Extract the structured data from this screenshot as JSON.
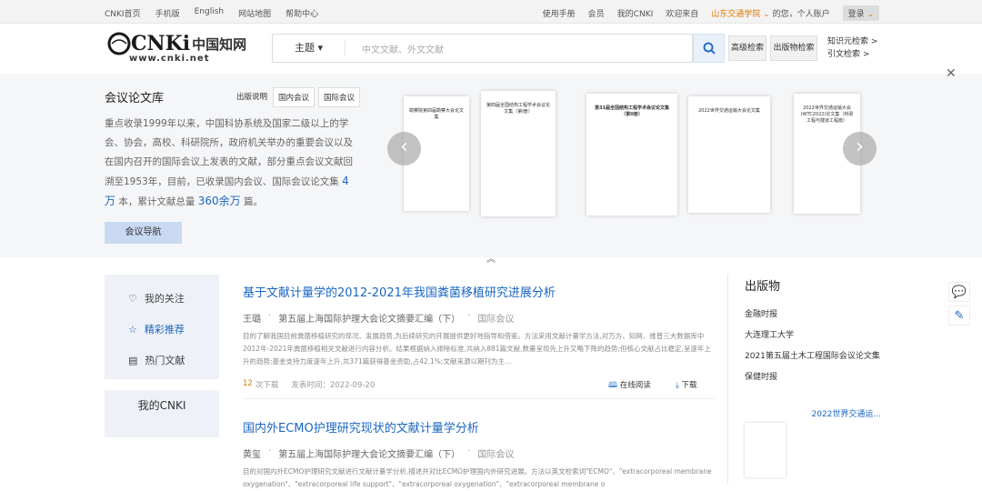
{
  "topbar": {
    "left": [
      "CNKI首页",
      "手机版",
      "English",
      "网站地图",
      "帮助中心"
    ],
    "right": [
      "使用手册",
      "会员",
      "我的CNKI",
      "欢迎来自"
    ],
    "org": "山东交通学院",
    "org_suffix": "的您，个人账户",
    "login": "登录"
  },
  "logo": {
    "mark": "CNKi",
    "cn": "中国知网",
    "url": "www.cnki.net"
  },
  "search": {
    "scope": "主题",
    "placeholder": "中文文献、外文文献"
  },
  "buttons": {
    "advanced": "高级检索",
    "publication": "出版物检索",
    "knowledge": "知识元检索",
    "citation": "引文检索"
  },
  "hero": {
    "title": "会议论文库",
    "tabs": [
      "出版说明",
      "国内会议",
      "国际会议"
    ],
    "desc_1": "重点收录1999年以来，中国科协系统及国家二级以上的学会、协会，高校、科研院所，政府机关举办的重要会议以及在国内召开的国际会议上发表的文献，部分重点会议文献回溯至1953年，目前，已收录国内会议、国际会议论文集",
    "num_1": "4万",
    "desc_2": "本，累计文献总量",
    "num_2": "360余万",
    "desc_3": "篇。",
    "nav_button": "会议导航",
    "books": [
      "勘察院第四届勘察大会论文集",
      "第四届全国结构工程学术会议论文集（第I册）",
      "第31届全国结构工程学术会议论文集（第II册）",
      "2022世界交通运输大会论文集",
      "2022世界交通运输大会(WTC2022)论文集（桥梁工程与隧道工程篇）"
    ]
  },
  "sidebar": {
    "items": [
      "我的关注",
      "精彩推荐",
      "热门文献"
    ],
    "mycnki": "我的CNKI"
  },
  "articles": [
    {
      "title": "基于文献计量学的2012-2021年我国粪菌移植研究进展分析",
      "author": "王璐",
      "source": "第五届上海国际护理大会论文摘要汇编（下）",
      "type": "国际会议",
      "abstract": "目的了解我国目前粪菌移植研究的现况、发展趋势,为后续研究的开展提供更好地指导和借鉴。方法采用文献计量学方法,对万方、知网、维普三大数据库中2012年-2021年粪菌移植相关文献进行内容分析。结果根据纳入排除标准,共纳入881篇文献,数量呈现先上升又略下降的趋势;但核心文献占比稳定,呈逐年上升的趋势;基金支持力度逐年上升,共371篇获得基金资助,占42.1%;文献来源以期刊为主…",
      "downloads": "12",
      "downloads_label": "次下载",
      "date": "发表时间：2022-09-20",
      "read": "在线阅读",
      "download": "下载"
    },
    {
      "title": "国内外ECMO护理研究现状的文献计量学分析",
      "author": "黄玺",
      "source": "第五届上海国际护理大会论文摘要汇编（下）",
      "type": "国际会议",
      "abstract": "目的对国内外ECMO护理研究文献进行文献计量学分析,描述并对比ECMO护理国内外研究进展。方法以英文检索词\"ECMO\"、\"extracorporeal membrane oxygenation\"、\"extracorporeal life support\"、\"extracorporeal oxygenation\"、\"extracorporeal membrane o"
    }
  ],
  "publications": {
    "title": "出版物",
    "items": [
      "金融时报",
      "大连理工大学",
      "2021第五届土木工程国际会议论文集",
      "保健时报"
    ],
    "featured": "2022世界交通运..."
  },
  "colors": {
    "accent": "#1a66c2",
    "org": "#e07b00"
  }
}
